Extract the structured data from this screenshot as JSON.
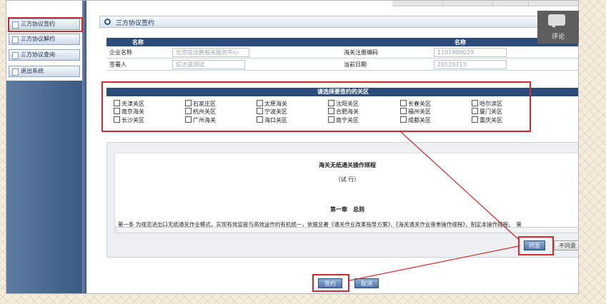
{
  "sidebar": {
    "items": [
      {
        "label": "三方协议签约"
      },
      {
        "label": "三方协议解约"
      },
      {
        "label": "三方协议查询"
      },
      {
        "label": "退出系统"
      }
    ]
  },
  "panel": {
    "title": "三方协议签约"
  },
  "comment": {
    "label": "评论"
  },
  "info": {
    "headers": [
      "名称",
      "名称"
    ],
    "rows": [
      {
        "label1": "企业名称",
        "value1": "北京信达鹏报关服务中心",
        "label2": "海关注册编码",
        "value2": "1101900029"
      },
      {
        "label1": "签署人",
        "value1": "信达诚测试",
        "label2": "当前日期",
        "value2": "20120713"
      }
    ]
  },
  "regions": {
    "title": "请选择要签约的关区",
    "items": [
      "天津关区",
      "石家庄区",
      "太原海关",
      "沈阳关区",
      "长春关区",
      "哈尔滨区",
      "南京海关",
      "杭州关区",
      "宁波关区",
      "合肥海关",
      "福州关区",
      "厦门关区",
      "长沙关区",
      "广州海关",
      "海口关区",
      "南宁关区",
      "成都关区",
      "重庆关区"
    ]
  },
  "rules": {
    "title": "海关无纸通关操作规程",
    "subtitle": "（试 行）",
    "chapter": "第一章　总则",
    "text": "第一条  为规范进出口无纸通关作业模式，实现有效监管与高效运作的有机统一，依据总署《通关作业改革指导方案》、《海关通关作业审单操作规程》，制定本操作规程。　第"
  },
  "buttons": {
    "agree": "同意",
    "disagree": "不同意",
    "sign": "签约",
    "cancel": "取消"
  },
  "colors": {
    "header_blue": "#2b4c78",
    "highlight_red": "#d12a2a"
  }
}
